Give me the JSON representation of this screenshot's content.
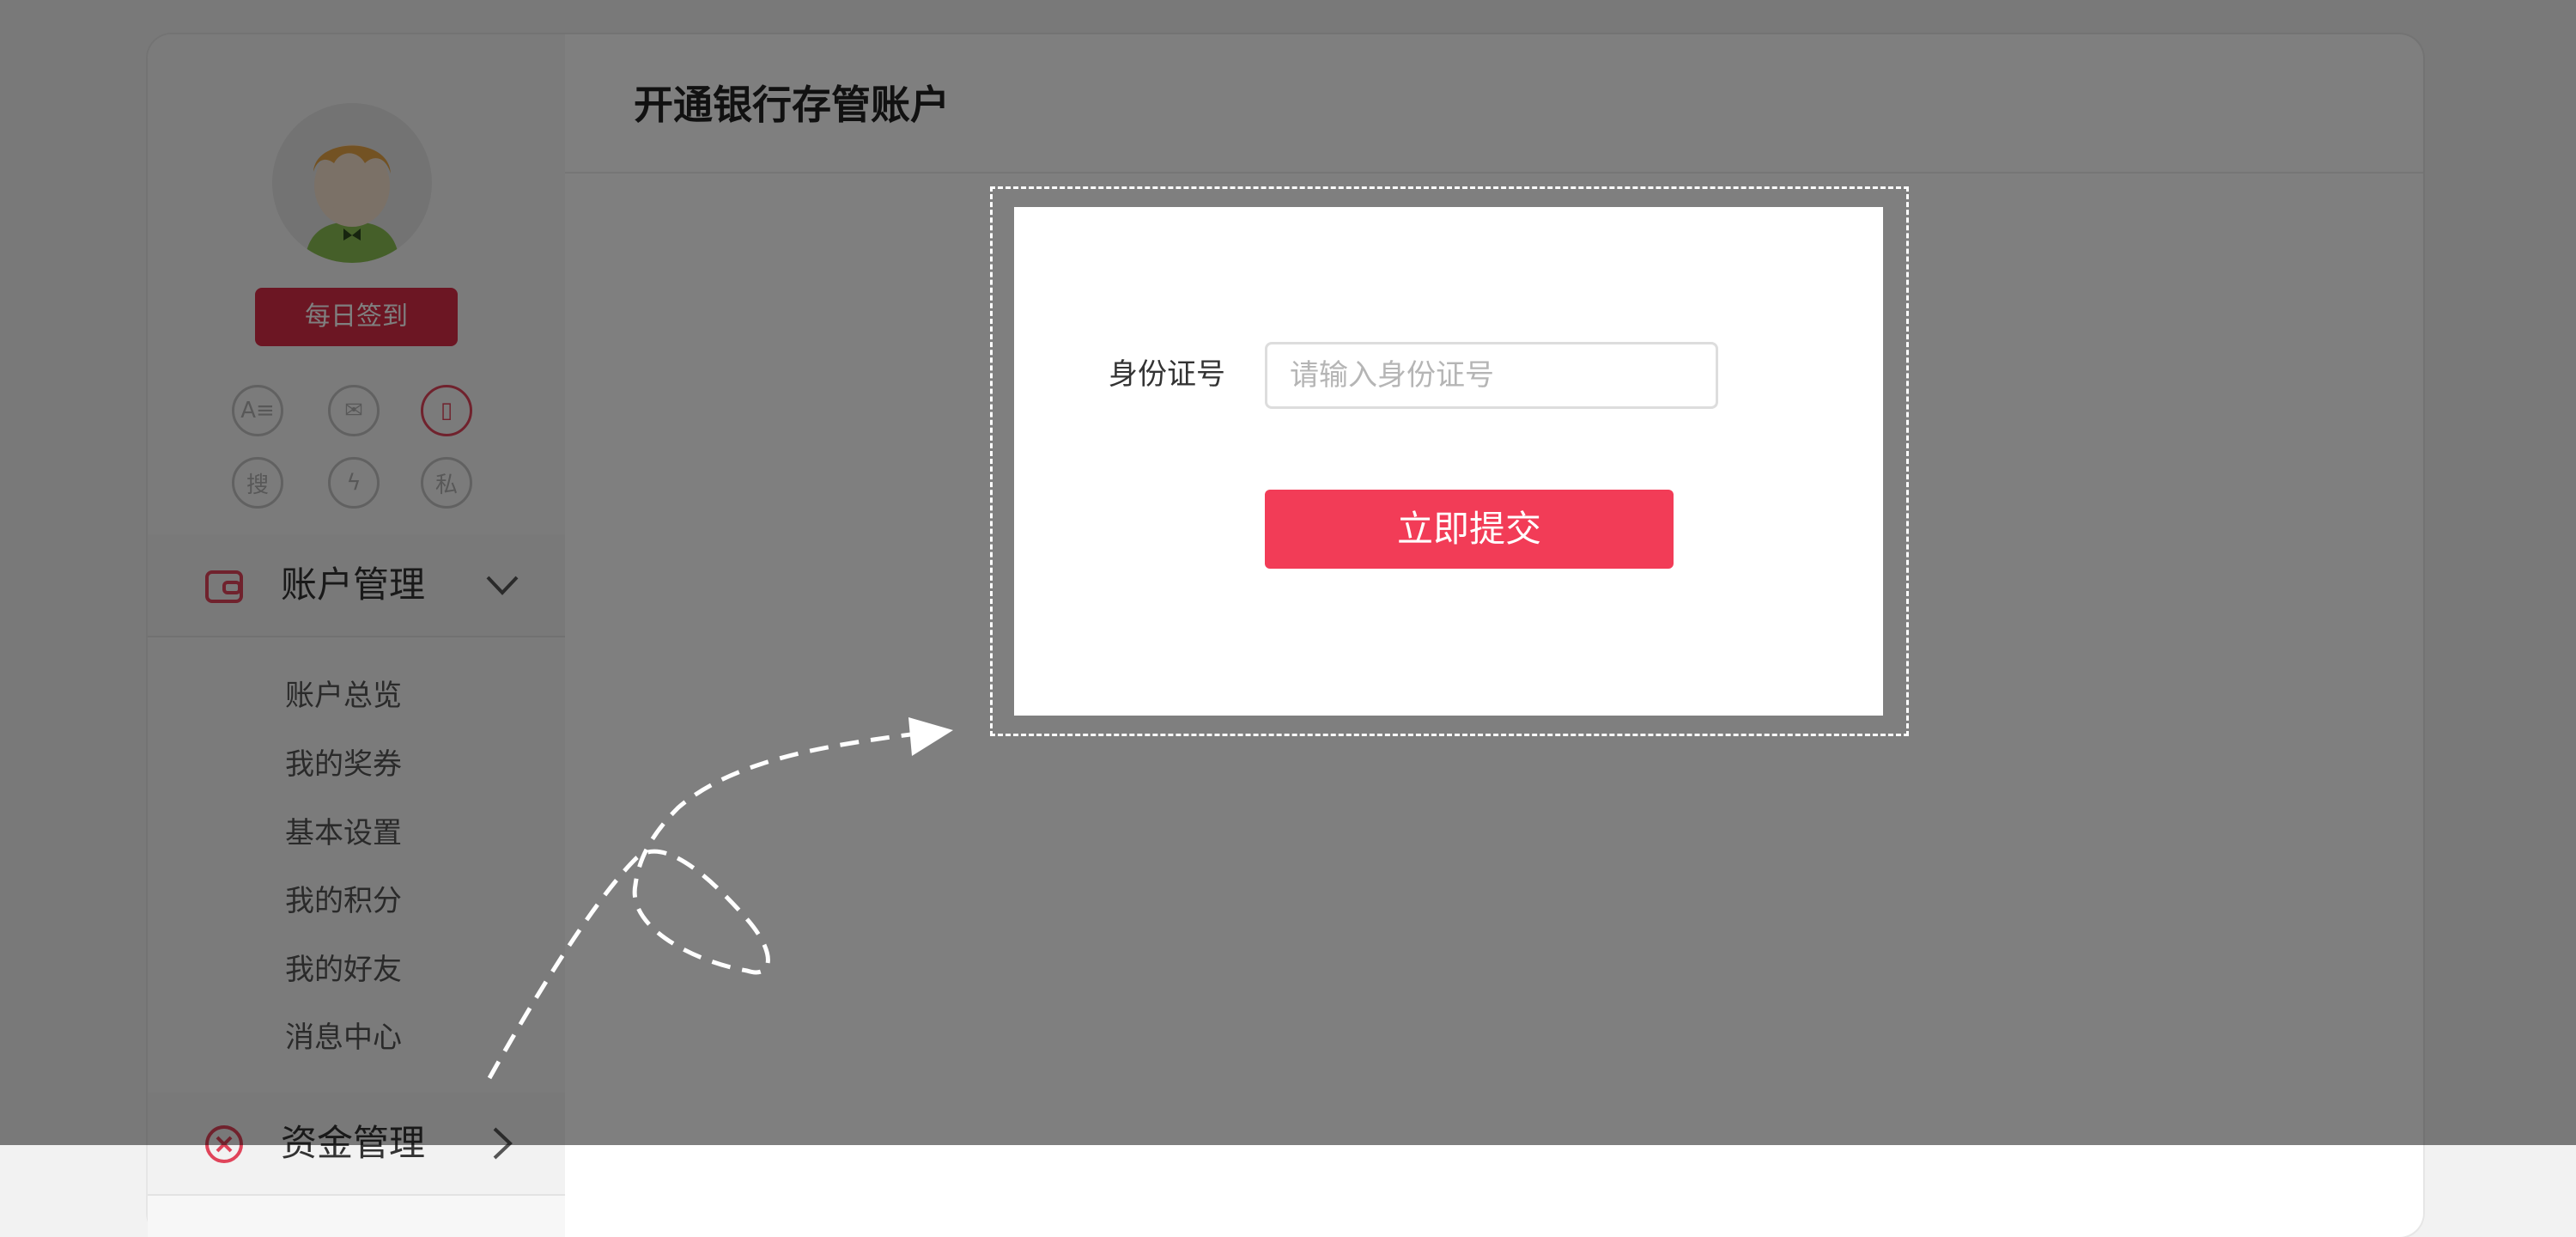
{
  "sidebar": {
    "signin_label": "每日签到",
    "quick_icons": [
      {
        "name": "card-icon",
        "glyph": "A≡"
      },
      {
        "name": "mail-icon",
        "glyph": "✉"
      },
      {
        "name": "phone-icon",
        "glyph": "▯"
      },
      {
        "name": "search-icon",
        "glyph": "搜"
      },
      {
        "name": "lightning-icon",
        "glyph": "ϟ"
      },
      {
        "name": "private-icon",
        "glyph": "私"
      }
    ],
    "account_menu": {
      "title": "账户管理",
      "items": [
        "账户总览",
        "我的奖券",
        "基本设置",
        "我的积分",
        "我的好友",
        "消息中心"
      ]
    },
    "funds_menu": {
      "title": "资金管理"
    }
  },
  "main": {
    "title": "开通银行存管账户"
  },
  "dialog": {
    "id_label": "身份证号",
    "id_placeholder": "请输入身份证号",
    "id_value": "",
    "submit_label": "立即提交"
  },
  "colors": {
    "brand_red": "#d82c46",
    "submit_red": "#f23c57",
    "overlay": "rgba(0,0,0,0.5)"
  }
}
